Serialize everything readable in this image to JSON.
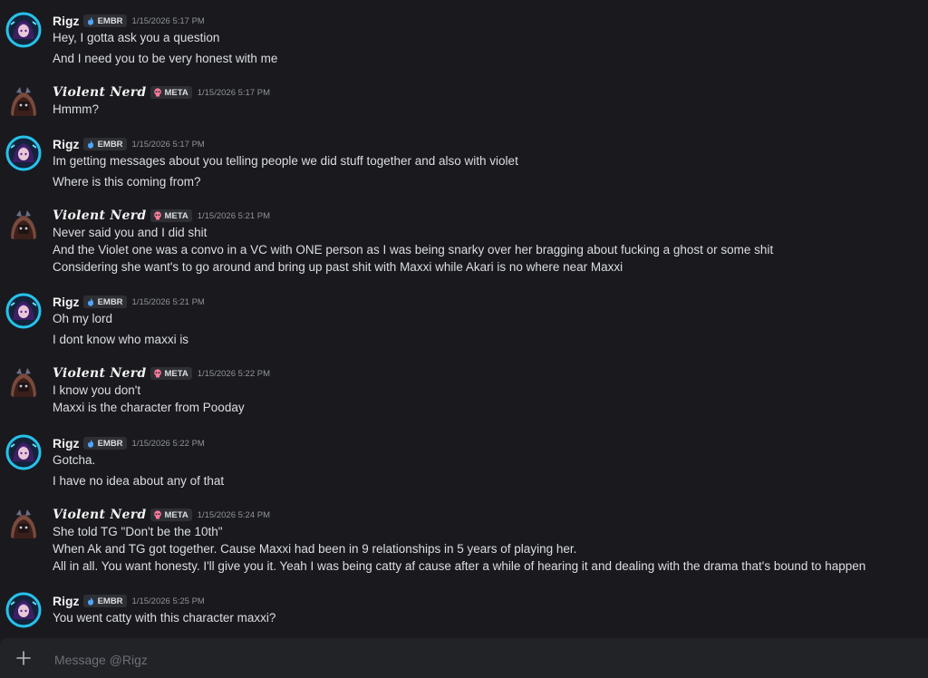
{
  "users": {
    "rigz": {
      "name": "Rigz",
      "tag": "EMBR",
      "tag_icon": "flame-icon"
    },
    "violent": {
      "name": "Violent Nerd",
      "tag": "META",
      "tag_icon": "skull-icon"
    }
  },
  "messages": [
    {
      "user": "rigz",
      "time": "1/15/2026 5:17 PM",
      "lines": [
        "Hey, I gotta ask you a question",
        "And I need you to be very honest with me"
      ]
    },
    {
      "user": "violent",
      "time": "1/15/2026 5:17 PM",
      "lines": [
        "Hmmm?"
      ]
    },
    {
      "user": "rigz",
      "time": "1/15/2026 5:17 PM",
      "lines": [
        "Im getting messages about you telling people we did stuff together and also with violet",
        "Where is this coming from?"
      ]
    },
    {
      "user": "violent",
      "time": "1/15/2026 5:21 PM",
      "lines": [
        "Never said you and I did shit",
        "And the Violet one was a convo in a VC with ONE person as I was being snarky over her bragging about fucking a ghost or some shit",
        "Considering she want's to go around and bring up past shit with Maxxi while Akari is no where near Maxxi"
      ]
    },
    {
      "user": "rigz",
      "time": "1/15/2026 5:21 PM",
      "lines": [
        "Oh my lord",
        "I dont know who maxxi is"
      ]
    },
    {
      "user": "violent",
      "time": "1/15/2026 5:22 PM",
      "lines": [
        "I know you don't",
        "Maxxi is the character from Pooday"
      ]
    },
    {
      "user": "rigz",
      "time": "1/15/2026 5:22 PM",
      "lines": [
        "Gotcha.",
        "I have no idea about any of that"
      ]
    },
    {
      "user": "violent",
      "time": "1/15/2026 5:24 PM",
      "lines": [
        "She told TG \"Don't be the 10th\"",
        "When Ak and TG got together. Cause Maxxi had been in 9 relationships in 5 years of playing her.",
        "All in all. You want honesty. I'll give you it. Yeah I was being catty af cause after a while of hearing it and dealing with the drama that's bound to happen"
      ]
    },
    {
      "user": "rigz",
      "time": "1/15/2026 5:25 PM",
      "lines": [
        "You went catty with this character maxxi?"
      ]
    }
  ],
  "composer": {
    "placeholder": "Message @Rigz",
    "plus_icon": "plus-icon"
  },
  "colors": {
    "background": "#1a1a1e",
    "composer": "#222327",
    "text": "#dbdee1",
    "timestamp": "#8e9297",
    "tag_bg": "#2e2f35"
  }
}
